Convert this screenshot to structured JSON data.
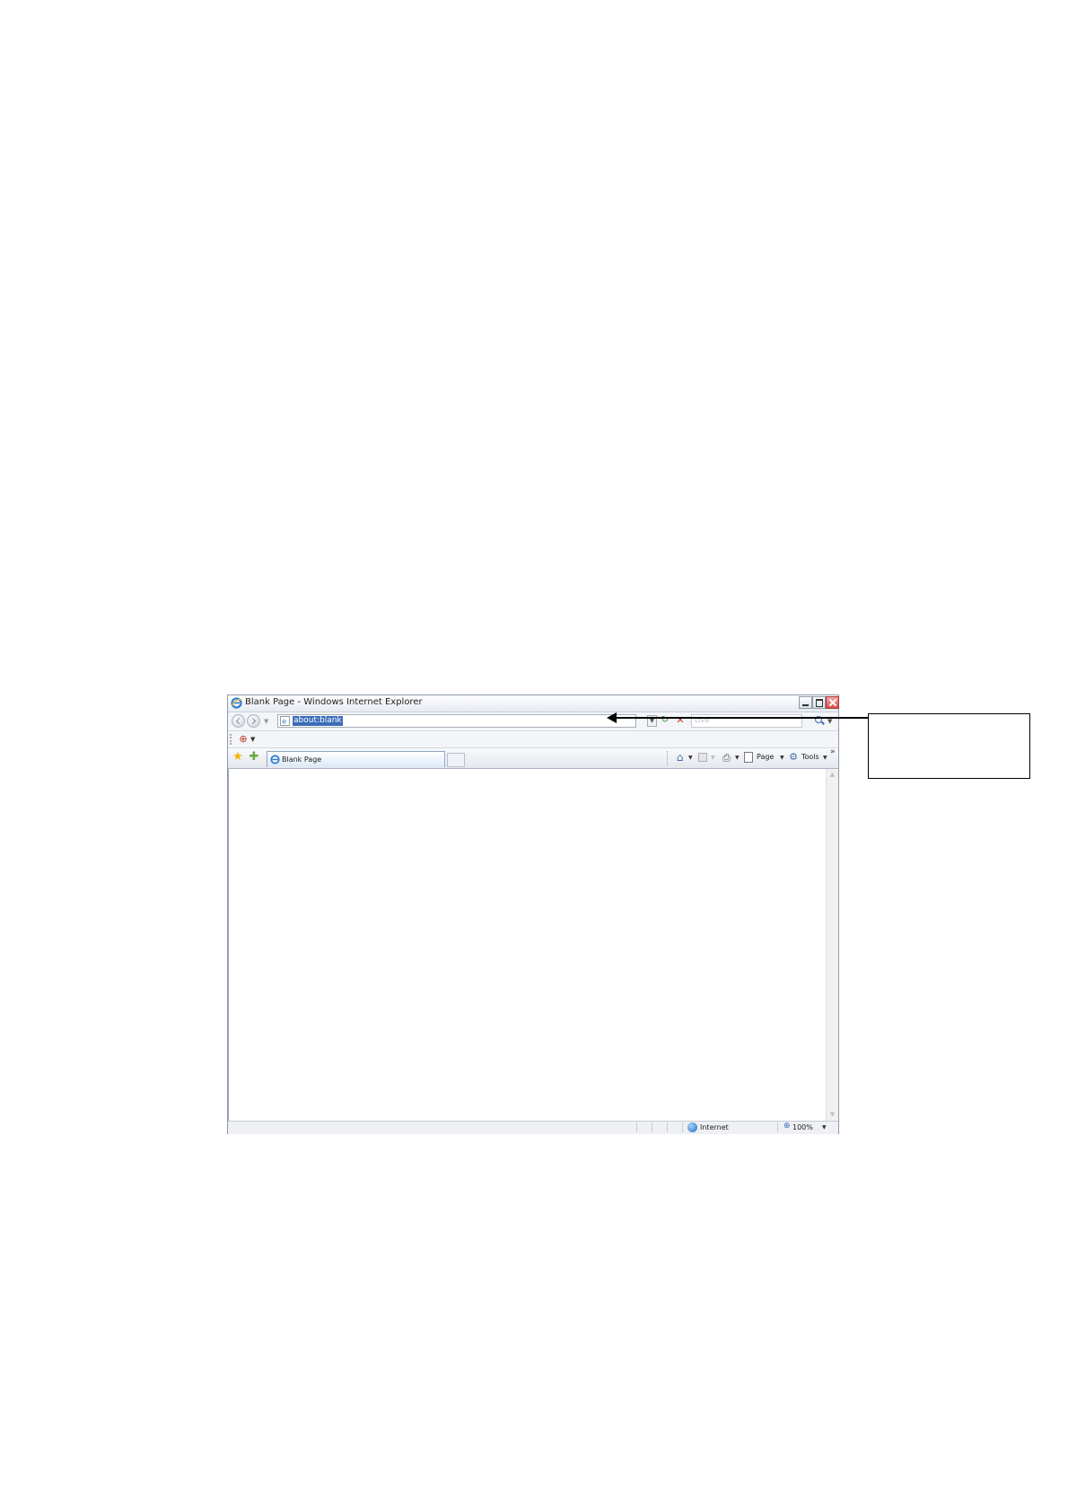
{
  "window": {
    "title": "Blank Page - Windows Internet Explorer"
  },
  "nav": {
    "address": "about:blank",
    "search_placeholder": "Live"
  },
  "tabs": [
    {
      "label": "Blank Page"
    }
  ],
  "command_bar": {
    "page_label": "Page",
    "tools_label": "Tools",
    "more": "»"
  },
  "status": {
    "zone": "Internet",
    "zoom": "100%"
  },
  "icons": {
    "refresh": "refresh-icon",
    "stop": "stop-icon",
    "favorites": "star-icon",
    "add_favorites": "add-favorites-icon",
    "home": "home-icon",
    "feeds": "feeds-icon",
    "print": "printer-icon",
    "tools": "gear-icon",
    "zone": "globe-icon"
  },
  "colors": {
    "address_highlight": "#3b6cb7",
    "close_button": "#d7524d"
  }
}
